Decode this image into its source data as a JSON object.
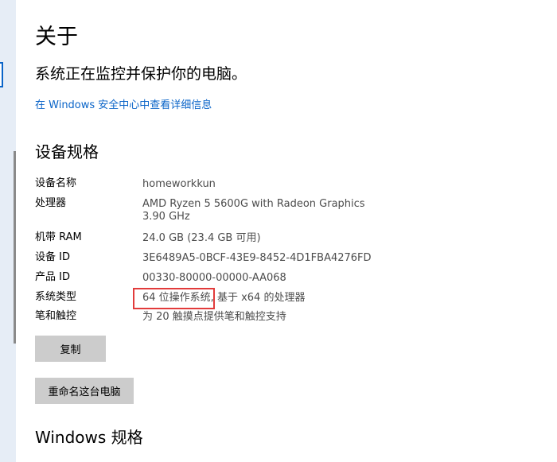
{
  "about": {
    "title": "关于",
    "protection_status": "系统正在监控并保护你的电脑。",
    "security_link": "在 Windows 安全中心中查看详细信息"
  },
  "device_specs": {
    "heading": "设备规格",
    "rows": [
      {
        "label": "设备名称",
        "value": "homeworkkun"
      },
      {
        "label": "处理器",
        "value": "AMD Ryzen 5 5600G with Radeon Graphics",
        "value_line2": "3.90 GHz"
      },
      {
        "label": "机带 RAM",
        "value": "24.0 GB (23.4 GB 可用)"
      },
      {
        "label": "设备 ID",
        "value": "3E6489A5-0BCF-43E9-8452-4D1FBA4276FD"
      },
      {
        "label": "产品 ID",
        "value": "00330-80000-00000-AA068"
      },
      {
        "label": "系统类型",
        "value": "64 位操作系统, 基于 x64 的处理器"
      },
      {
        "label": "笔和触控",
        "value": "为 20 触摸点提供笔和触控支持"
      }
    ]
  },
  "buttons": {
    "copy": "复制",
    "rename": "重命名这台电脑"
  },
  "windows_specs": {
    "heading": "Windows 规格"
  },
  "colors": {
    "link": "#0a64c8",
    "value_text": "#4c4c4c",
    "highlight": "#e23b3b",
    "button_bg": "#cccccc"
  }
}
